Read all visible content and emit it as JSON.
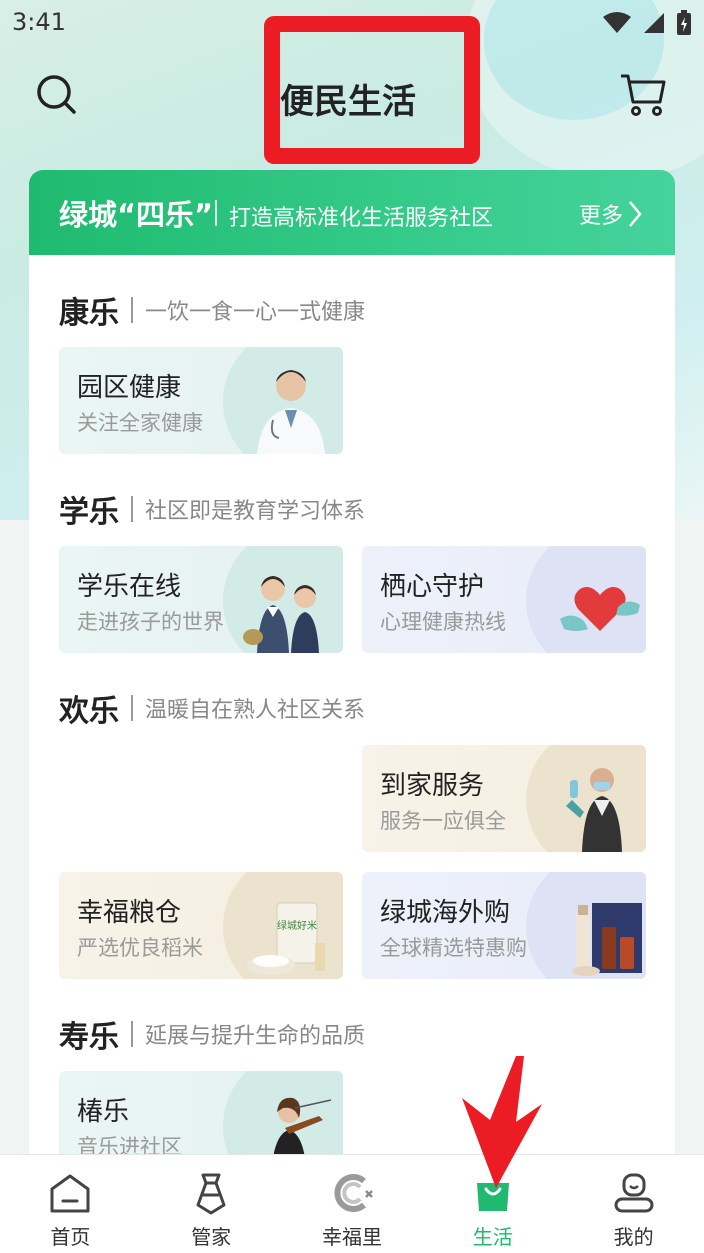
{
  "status_bar": {
    "time": "3:41"
  },
  "header": {
    "title": "便民生活"
  },
  "banner": {
    "title": "绿城“四乐”",
    "subtitle": "打造高标准化生活服务社区",
    "more": "更多"
  },
  "sections": [
    {
      "title": "康乐",
      "subtitle": "一饮一食一心一式健康",
      "tiles": [
        {
          "title": "园区健康",
          "subtitle": "关注全家健康"
        }
      ]
    },
    {
      "title": "学乐",
      "subtitle": "社区即是教育学习体系",
      "tiles": [
        {
          "title": "学乐在线",
          "subtitle": "走进孩子的世界"
        },
        {
          "title": "栖心守护",
          "subtitle": "心理健康热线"
        }
      ]
    },
    {
      "title": "欢乐",
      "subtitle": "温暖自在熟人社区关系",
      "tiles": [
        {
          "title": "到家服务",
          "subtitle": "服务一应俱全"
        },
        {
          "title": "幸福粮仓",
          "subtitle": "严选优良稻米"
        },
        {
          "title": "绿城海外购",
          "subtitle": "全球精选特惠购"
        }
      ]
    },
    {
      "title": "寿乐",
      "subtitle": "延展与提升生命的品质",
      "tiles": [
        {
          "title": "椿乐",
          "subtitle": "音乐进社区"
        }
      ]
    }
  ],
  "rice_bag_text": "绿城好米",
  "nav": [
    {
      "label": "首页",
      "icon": "home-icon"
    },
    {
      "label": "管家",
      "icon": "butler-icon"
    },
    {
      "label": "幸福里",
      "icon": "xingfuli-icon"
    },
    {
      "label": "生活",
      "icon": "life-bag-icon",
      "active": true
    },
    {
      "label": "我的",
      "icon": "profile-icon"
    }
  ],
  "colors": {
    "accent": "#1fba6f",
    "annotation": "#ec1c24"
  }
}
